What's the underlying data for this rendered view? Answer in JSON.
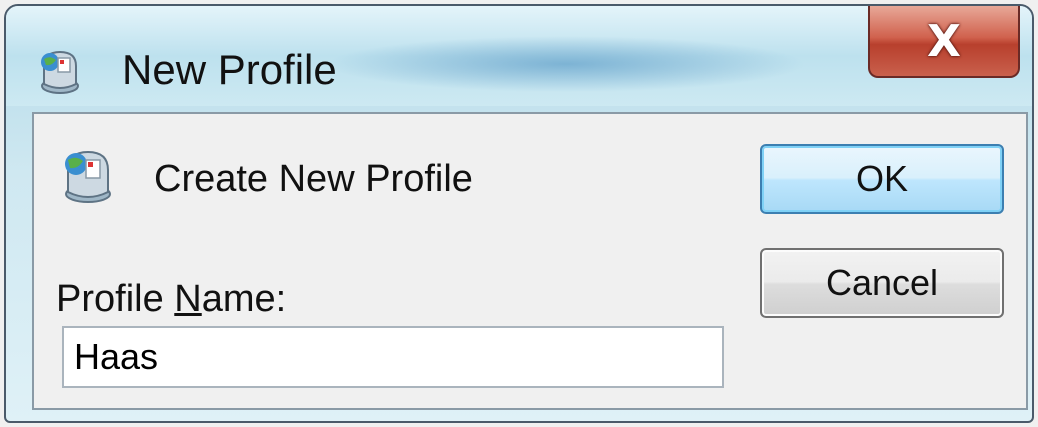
{
  "window": {
    "title": "New Profile",
    "close_glyph": "X"
  },
  "dialog": {
    "header": "Create New Profile",
    "profile_label_pre": "Profile ",
    "profile_label_accel": "N",
    "profile_label_post": "ame:",
    "profile_name_value": "Haas"
  },
  "buttons": {
    "ok": "OK",
    "cancel": "Cancel"
  },
  "icons": {
    "title": "profile-globe-icon",
    "header": "profile-globe-icon"
  },
  "colors": {
    "ok_border": "#3c7fb1",
    "close_red": "#c9604c"
  }
}
